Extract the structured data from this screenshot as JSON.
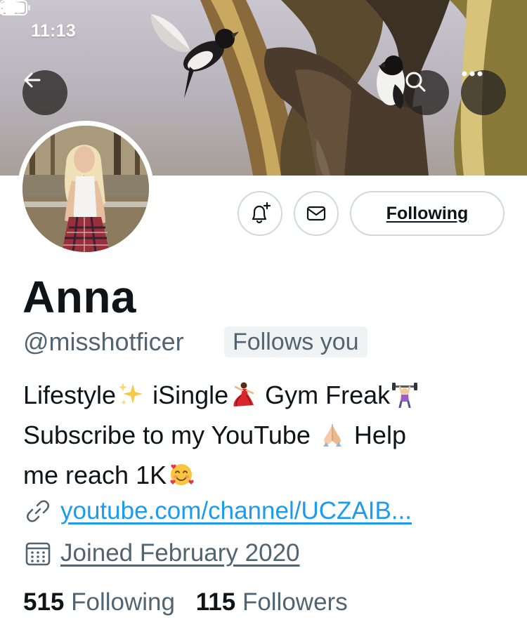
{
  "status_bar": {
    "time": "11:13",
    "icons": [
      "location-arrow-icon",
      "signal-icon",
      "wifi-icon",
      "battery-icon"
    ]
  },
  "header": {
    "buttons": [
      "back-arrow-icon",
      "search-icon",
      "more-icon"
    ]
  },
  "profile": {
    "name": "Anna",
    "handle": "@misshotficer",
    "follows_you": "Follows you",
    "bio_lines": [
      [
        "Lifestyle",
        " iSingle",
        " Gym Freak"
      ],
      [
        "Subscribe to my YouTube ",
        " Help"
      ],
      [
        "me reach 1K"
      ]
    ],
    "bio_emojis": [
      "sparkles",
      "dancer",
      "weightlifter",
      "folded-hands",
      "smiling-face-with-hearts"
    ],
    "link": "youtube.com/channel/UCZAIB...",
    "joined": "Joined February 2020",
    "following_count": "515",
    "following_label": "Following",
    "followers_count": "115",
    "followers_label": "Followers"
  },
  "actions": {
    "following_button": "Following",
    "notify_icon": "bell-plus-icon",
    "message_icon": "envelope-icon"
  },
  "colors": {
    "link": "#1d9bf0",
    "secondary_text": "#536471",
    "primary_text": "#0f1419",
    "border": "#cfd9de"
  }
}
